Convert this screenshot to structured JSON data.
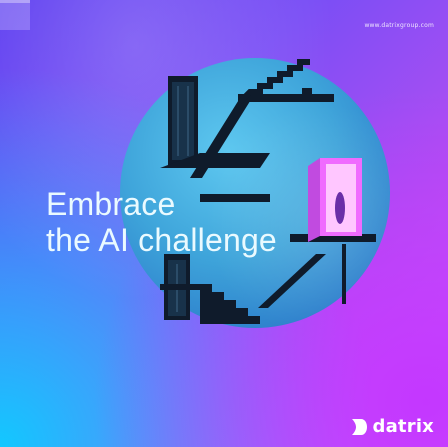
{
  "branding": {
    "website": "www.datrixgroup.com",
    "logo_text": "datrix"
  },
  "headline": {
    "line1": "Embrace",
    "line2": "the AI challenge"
  },
  "colors": {
    "gradient_blue": "#12c8ff",
    "gradient_violet": "#7a4ef5",
    "gradient_magenta": "#d45aff",
    "circle_blue": "#3ea4da",
    "stair_dark": "#0f1b2b",
    "door_glow": "#f06bff"
  },
  "icons": {
    "logo_mark": "datrix-logo-icon",
    "corner_mark": "corner-mark-icon"
  }
}
